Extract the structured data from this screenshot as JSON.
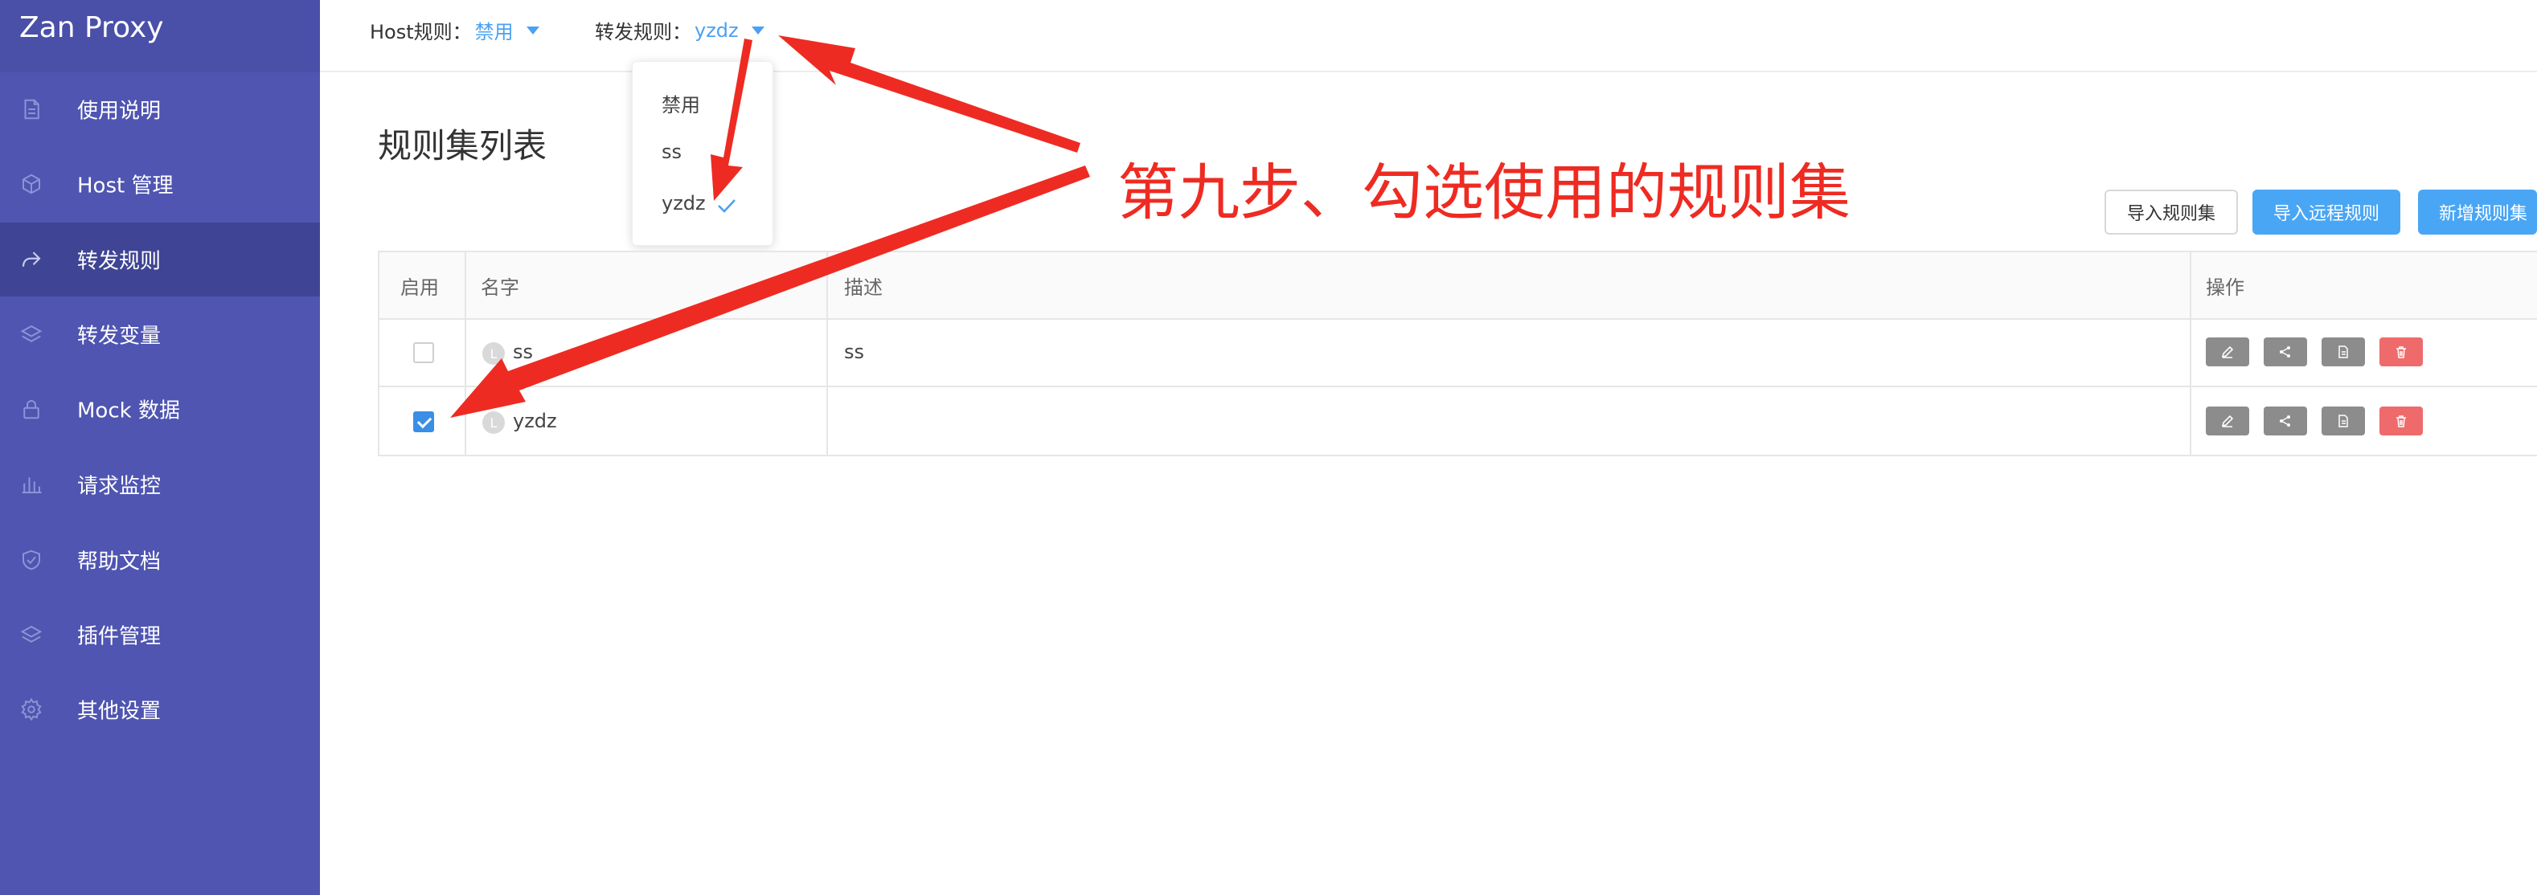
{
  "app": {
    "title": "Zan Proxy"
  },
  "sidebar": {
    "items": [
      {
        "label": "使用说明",
        "icon": "document-icon",
        "active": false
      },
      {
        "label": "Host 管理",
        "icon": "cube-icon",
        "active": false
      },
      {
        "label": "转发规则",
        "icon": "share-forward-icon",
        "active": true
      },
      {
        "label": "转发变量",
        "icon": "layers-icon",
        "active": false
      },
      {
        "label": "Mock 数据",
        "icon": "lock-icon",
        "active": false
      },
      {
        "label": "请求监控",
        "icon": "bar-chart-icon",
        "active": false
      },
      {
        "label": "帮助文档",
        "icon": "shield-check-icon",
        "active": false
      },
      {
        "label": "插件管理",
        "icon": "layers-icon",
        "active": false
      },
      {
        "label": "其他设置",
        "icon": "gear-icon",
        "active": false
      }
    ]
  },
  "topbar": {
    "host_label": "Host规则：",
    "host_value": "禁用",
    "forward_label": "转发规则：",
    "forward_value": "yzdz"
  },
  "dropdown": {
    "options": [
      "禁用",
      "ss",
      "yzdz"
    ],
    "selected": "yzdz"
  },
  "main": {
    "title": "规则集列表",
    "buttons": {
      "import": "导入规则集",
      "import_remote": "导入远程规则",
      "add_new": "新增规则集"
    },
    "table": {
      "headers": {
        "enabled": "启用",
        "name": "名字",
        "description": "描述",
        "actions": "操作"
      },
      "rows": [
        {
          "enabled": false,
          "avatar": "L",
          "name": "ss",
          "description": "ss"
        },
        {
          "enabled": true,
          "avatar": "L",
          "name": "yzdz",
          "description": ""
        }
      ]
    }
  },
  "annotation": {
    "text": "第九步、勾选使用的规则集"
  },
  "colors": {
    "sidebar": "#4f55b1",
    "accent": "#49a6f5",
    "danger": "#ef6b6b",
    "annotation": "#ee2b22"
  }
}
